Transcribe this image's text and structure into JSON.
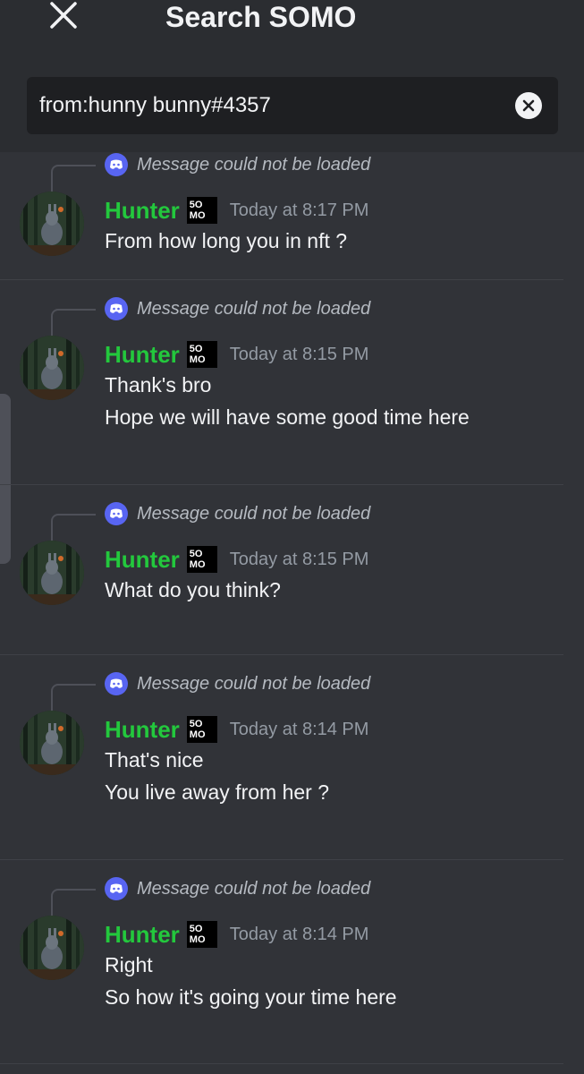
{
  "header": {
    "title": "Search SOMO",
    "close_icon": "close-icon"
  },
  "search": {
    "value": "from:hunny bunny#4357",
    "clear_icon": "clear-icon"
  },
  "results": [
    {
      "reply": "Message could not be loaded",
      "author": "Hunter",
      "badge": [
        "5O",
        "MO"
      ],
      "timestamp": "Today at 8:17 PM",
      "lines": [
        "From how long you in nft ?"
      ]
    },
    {
      "reply": "Message could not be loaded",
      "author": "Hunter",
      "badge": [
        "5O",
        "MO"
      ],
      "timestamp": "Today at 8:15 PM",
      "lines": [
        "Thank's bro",
        "Hope we will have some good time here"
      ]
    },
    {
      "reply": "Message could not be loaded",
      "author": "Hunter",
      "badge": [
        "5O",
        "MO"
      ],
      "timestamp": "Today at 8:15 PM",
      "lines": [
        "What do you think?"
      ]
    },
    {
      "reply": "Message could not be loaded",
      "author": "Hunter",
      "badge": [
        "5O",
        "MO"
      ],
      "timestamp": "Today at 8:14 PM",
      "lines": [
        "That's nice",
        "You live away from her ?"
      ]
    },
    {
      "reply": "Message could not be loaded",
      "author": "Hunter",
      "badge": [
        "5O",
        "MO"
      ],
      "timestamp": "Today at 8:14 PM",
      "lines": [
        "Right",
        "So how it's going your time here"
      ]
    }
  ],
  "colors": {
    "background": "#313338",
    "header": "#2b2d31",
    "author": "#23c83d",
    "discord_blue": "#5865f2"
  }
}
